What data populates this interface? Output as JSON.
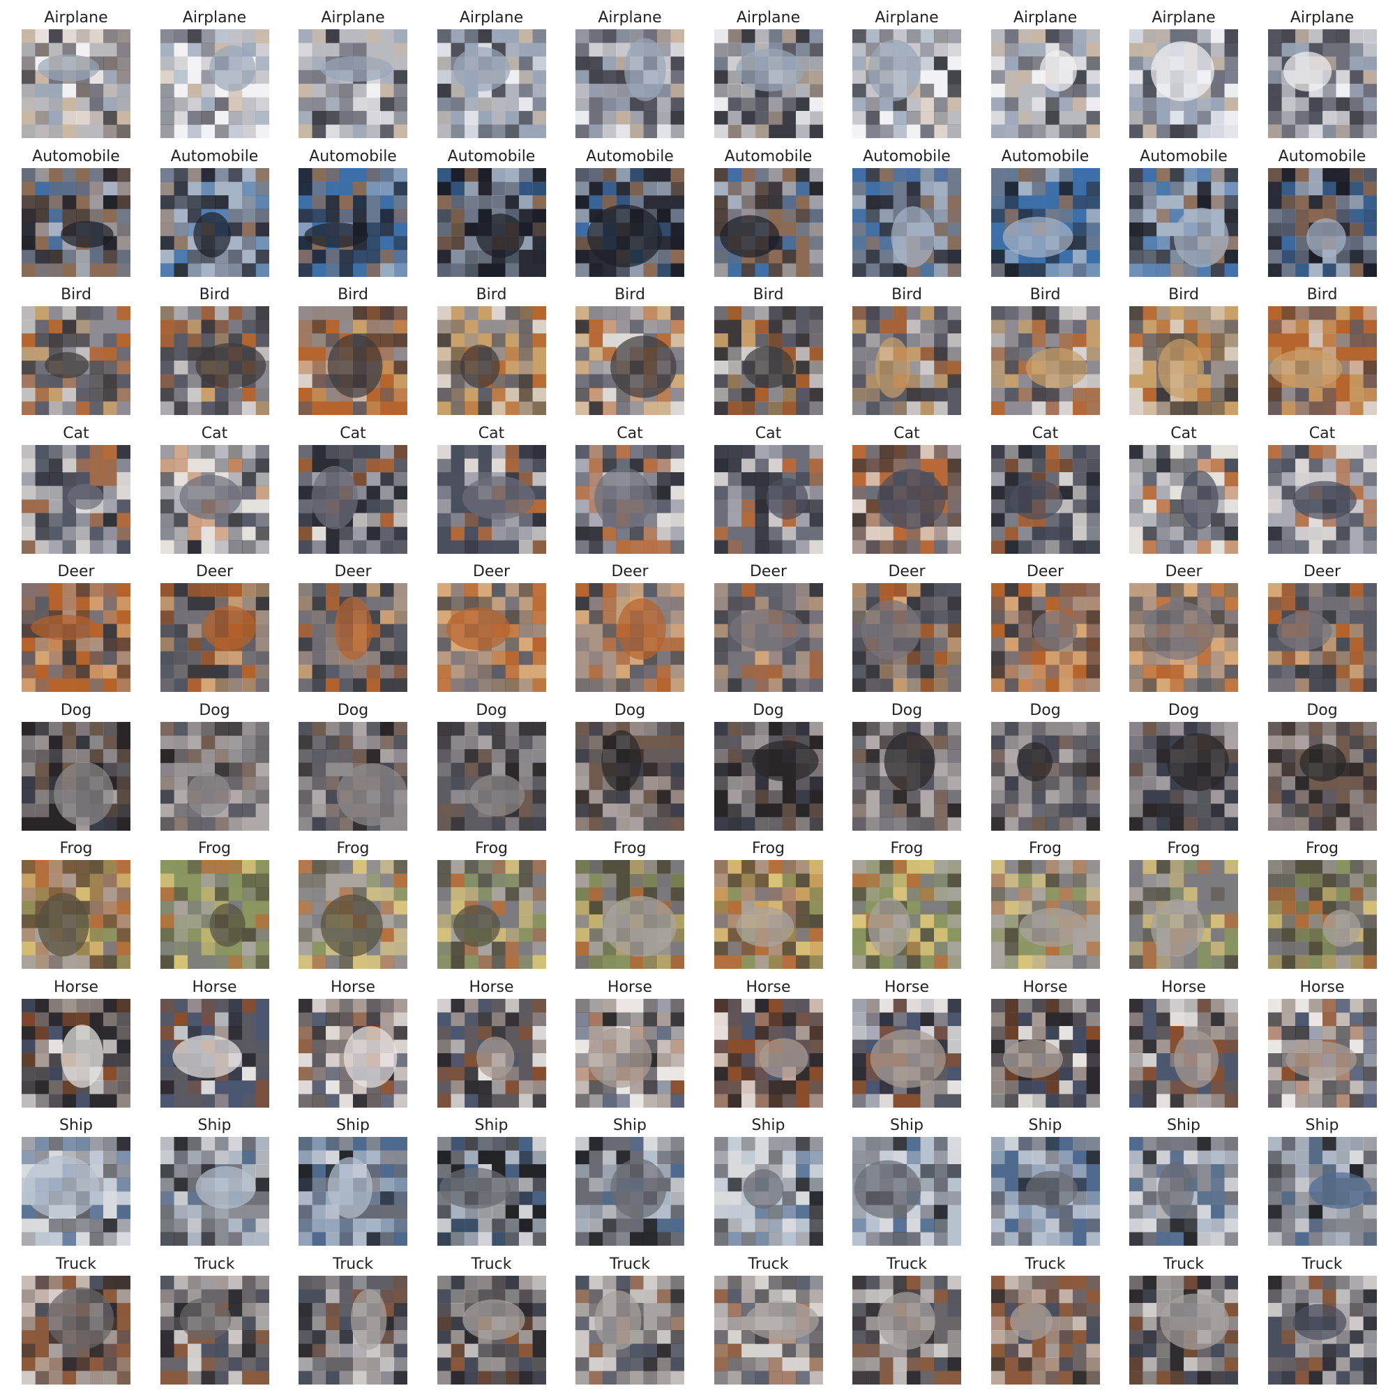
{
  "grid": {
    "rows": [
      {
        "label": "Airplane",
        "palette": [
          "#b9b9c0",
          "#6f707c",
          "#f2f2f5",
          "#9aa6b8",
          "#3c3c44",
          "#c9b7a4"
        ]
      },
      {
        "label": "Automobile",
        "palette": [
          "#3d6fa8",
          "#2a2d38",
          "#6f7a8c",
          "#a6b4c6",
          "#1c1f28",
          "#8c6b55"
        ]
      },
      {
        "label": "Bird",
        "palette": [
          "#8e8c92",
          "#b5652e",
          "#dcd8d6",
          "#5a5a66",
          "#c9a06a",
          "#3e3a3c"
        ]
      },
      {
        "label": "Cat",
        "palette": [
          "#6c6e7a",
          "#2c2e36",
          "#a9a9b3",
          "#b76a38",
          "#e4e0dc",
          "#4b4f5e"
        ]
      },
      {
        "label": "Deer",
        "palette": [
          "#77737a",
          "#b6632c",
          "#5a5c66",
          "#a99486",
          "#3a3a40",
          "#d7a878"
        ]
      },
      {
        "label": "Dog",
        "palette": [
          "#5e5c62",
          "#2a2628",
          "#8f8a8c",
          "#6f5a4e",
          "#b0a9aa",
          "#3c3f4c"
        ]
      },
      {
        "label": "Frog",
        "palette": [
          "#7c7b80",
          "#b4703c",
          "#a9a49e",
          "#54503f",
          "#d9c47a",
          "#8a9560"
        ]
      },
      {
        "label": "Horse",
        "palette": [
          "#5e5a5e",
          "#8a4e2c",
          "#2c2a2e",
          "#a99c96",
          "#eae6e4",
          "#4b5670"
        ]
      },
      {
        "label": "Ship",
        "palette": [
          "#8a8c94",
          "#222428",
          "#d8dade",
          "#4f6a8e",
          "#6a6c74",
          "#b7c2d0"
        ]
      },
      {
        "label": "Truck",
        "palette": [
          "#6a6568",
          "#2e2c30",
          "#d6d2d0",
          "#8c5a3c",
          "#4a4f5e",
          "#a8a2a0"
        ]
      }
    ],
    "columns": 10
  }
}
